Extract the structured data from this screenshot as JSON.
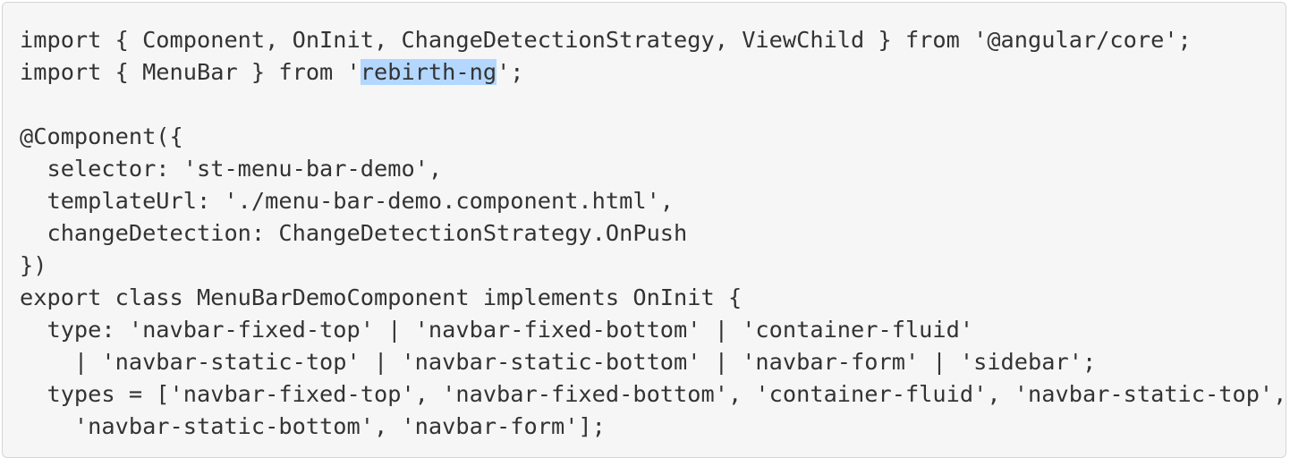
{
  "code": {
    "lines": [
      "import { Component, OnInit, ChangeDetectionStrategy, ViewChild } from '@angular/core';",
      "",
      "",
      "@Component({",
      "  selector: 'st-menu-bar-demo',",
      "  templateUrl: './menu-bar-demo.component.html',",
      "  changeDetection: ChangeDetectionStrategy.OnPush",
      "})",
      "export class MenuBarDemoComponent implements OnInit {",
      "  type: 'navbar-fixed-top' | 'navbar-fixed-bottom' | 'container-fluid'",
      "    | 'navbar-static-top' | 'navbar-static-bottom' | 'navbar-form' | 'sidebar';",
      "  types = ['navbar-fixed-top', 'navbar-fixed-bottom', 'container-fluid', 'navbar-static-top',",
      "    'navbar-static-bottom', 'navbar-form'];"
    ],
    "line2": {
      "before": "import { MenuBar } from '",
      "selected": "rebirth-ng",
      "after": "';"
    }
  },
  "colors": {
    "background": "#f6f6f6",
    "text": "#333333",
    "selection": "#b3d7fe"
  }
}
